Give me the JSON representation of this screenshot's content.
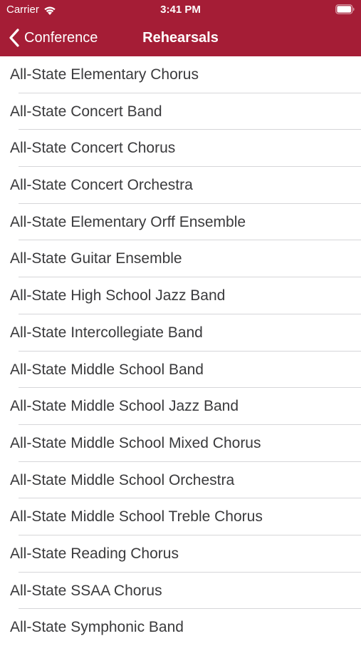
{
  "status_bar": {
    "carrier": "Carrier",
    "time": "3:41 PM"
  },
  "nav": {
    "back_label": "Conference",
    "title": "Rehearsals"
  },
  "colors": {
    "header_background": "#a51d36",
    "header_text": "#ffffff",
    "list_text": "#3a3a3c",
    "separator": "#d6d6d9"
  },
  "icons": {
    "wifi": "wifi-icon",
    "battery": "battery-icon",
    "back": "chevron-left-icon"
  },
  "rehearsals": [
    "All-State Elementary Chorus",
    "All-State Concert Band",
    "All-State Concert Chorus",
    "All-State Concert Orchestra",
    "All-State Elementary Orff Ensemble",
    "All-State Guitar Ensemble",
    "All-State High School Jazz Band",
    "All-State Intercollegiate Band",
    "All-State Middle School Band",
    "All-State Middle School Jazz Band",
    "All-State Middle School Mixed Chorus",
    "All-State Middle School Orchestra",
    "All-State Middle School Treble Chorus",
    "All-State Reading Chorus",
    "All-State SSAA Chorus",
    "All-State Symphonic Band"
  ]
}
